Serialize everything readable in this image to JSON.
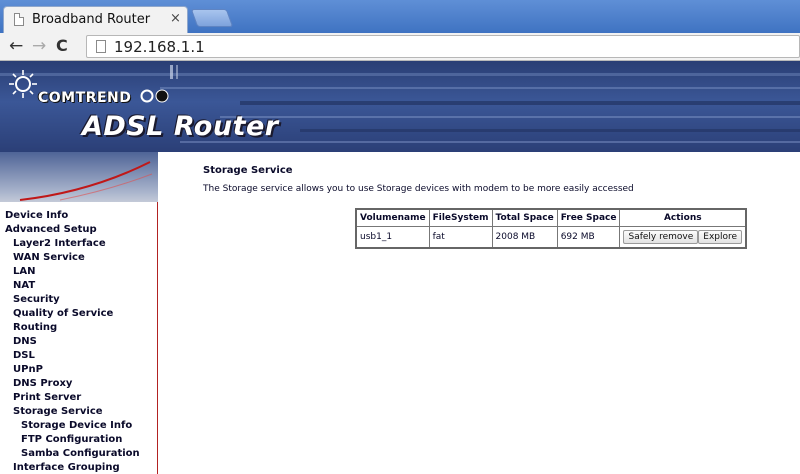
{
  "browser": {
    "tab_title": "Broadband Router",
    "tab_close": "×",
    "url": "192.168.1.1",
    "back_icon": "←",
    "forward_icon": "→",
    "reload_icon": "C"
  },
  "banner": {
    "brand": "COMTREND",
    "product": "ADSL Router"
  },
  "sidebar": {
    "items": [
      {
        "label": "Device Info",
        "level": 0
      },
      {
        "label": "Advanced Setup",
        "level": 0
      },
      {
        "label": "Layer2 Interface",
        "level": 1
      },
      {
        "label": "WAN Service",
        "level": 1
      },
      {
        "label": "LAN",
        "level": 1
      },
      {
        "label": "NAT",
        "level": 1
      },
      {
        "label": "Security",
        "level": 1
      },
      {
        "label": "Quality of Service",
        "level": 1
      },
      {
        "label": "Routing",
        "level": 1
      },
      {
        "label": "DNS",
        "level": 1
      },
      {
        "label": "DSL",
        "level": 1
      },
      {
        "label": "UPnP",
        "level": 1
      },
      {
        "label": "DNS Proxy",
        "level": 1
      },
      {
        "label": "Print Server",
        "level": 1
      },
      {
        "label": "Storage Service",
        "level": 1
      },
      {
        "label": "Storage Device Info",
        "level": 2
      },
      {
        "label": "FTP Configuration",
        "level": 2
      },
      {
        "label": "Samba Configuration",
        "level": 2
      },
      {
        "label": "Interface Grouping",
        "level": 1
      }
    ]
  },
  "main": {
    "title": "Storage Service",
    "description": "The Storage service allows you to use Storage devices with modem to be more easily accessed",
    "table": {
      "headers": [
        "Volumename",
        "FileSystem",
        "Total Space",
        "Free Space",
        "Actions"
      ],
      "rows": [
        {
          "volumename": "usb1_1",
          "filesystem": "fat",
          "total": "2008 MB",
          "free": "692 MB"
        }
      ],
      "actions": {
        "remove": "Safely remove",
        "explore": "Explore"
      }
    }
  }
}
